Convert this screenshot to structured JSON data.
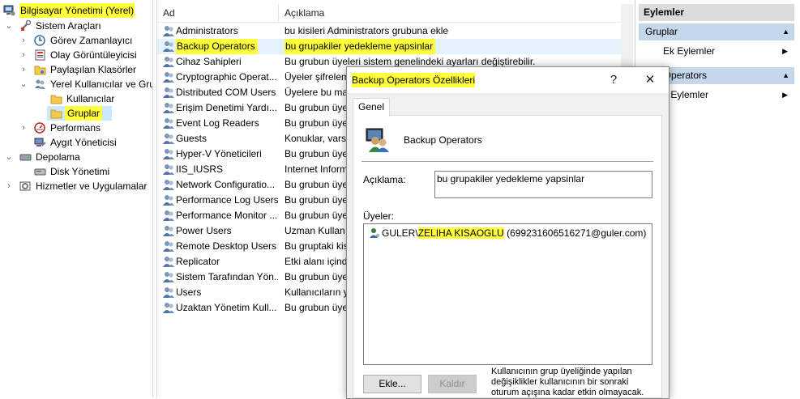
{
  "tree": {
    "root": "Bilgisayar Yönetimi (Yerel)",
    "items": [
      {
        "label": "Sistem Araçları"
      },
      {
        "label": "Görev Zamanlayıcı"
      },
      {
        "label": "Olay Görüntüleyicisi"
      },
      {
        "label": "Paylaşılan Klasörler"
      },
      {
        "label": "Yerel Kullanıcılar ve Gru"
      },
      {
        "label": "Kullanıcılar"
      },
      {
        "label": "Gruplar"
      },
      {
        "label": "Performans"
      },
      {
        "label": "Aygıt Yöneticisi"
      },
      {
        "label": "Depolama"
      },
      {
        "label": "Disk Yönetimi"
      },
      {
        "label": "Hizmetler ve Uygulamalar"
      }
    ]
  },
  "list": {
    "columns": {
      "name": "Ad",
      "description": "Açıklama"
    },
    "rows": [
      {
        "name": "Administrators",
        "desc": "bu kisileri Administrators grubuna ekle"
      },
      {
        "name": "Backup Operators",
        "desc": "bu grupakiler yedekleme yapsinlar"
      },
      {
        "name": "Cihaz Sahipleri",
        "desc": "Bu grubun üyeleri sistem genelindeki ayarları değiştirebilir."
      },
      {
        "name": "Cryptographic Operat...",
        "desc": "Üyeler şifrelem"
      },
      {
        "name": "Distributed COM Users",
        "desc": "Üyelere bu ma"
      },
      {
        "name": "Erişim Denetimi Yardı...",
        "desc": "Bu grubun üye"
      },
      {
        "name": "Event Log Readers",
        "desc": "Bu grubun üye"
      },
      {
        "name": "Guests",
        "desc": "Konuklar, varsa"
      },
      {
        "name": "Hyper-V Yöneticileri",
        "desc": "Bu grubun üye"
      },
      {
        "name": "IIS_IUSRS",
        "desc": "Internet Inform"
      },
      {
        "name": "Network Configuratio...",
        "desc": "Bu grubun üye"
      },
      {
        "name": "Performance Log Users",
        "desc": "Bu grubun üye"
      },
      {
        "name": "Performance Monitor ...",
        "desc": "Bu grubun üye"
      },
      {
        "name": "Power Users",
        "desc": "Uzman Kullan"
      },
      {
        "name": "Remote Desktop Users",
        "desc": "Bu gruptaki kis"
      },
      {
        "name": "Replicator",
        "desc": "Etki alanı içind"
      },
      {
        "name": "Sistem Tarafından Yön...",
        "desc": "Bu grubun üye"
      },
      {
        "name": "Users",
        "desc": "Kullanıcıların y"
      },
      {
        "name": "Uzaktan Yönetim Kull...",
        "desc": "Bu grubun üye"
      }
    ]
  },
  "actions": {
    "header": "Eylemler",
    "section1": "Gruplar",
    "more1": "Ek Eylemler",
    "section2": "kup Operators",
    "more2": "k Eylemler"
  },
  "dialog": {
    "title": "Backup Operators Özellikleri",
    "help": "?",
    "close": "✕",
    "tab": "Genel",
    "group_name": "Backup Operators",
    "desc_label": "Açıklama:",
    "desc_value": "bu grupakiler yedekleme yapsinlar",
    "members_label": "Üyeler:",
    "member_prefix": "GULER\\",
    "member_name": "ZELIHA KISAOGLU",
    "member_suffix": " (699231606516271@guler.com)",
    "add": "Ekle...",
    "remove": "Kaldır",
    "note": "Kullanıcının grup üyeliğinde yapılan değişiklikler kullanıcının bir sonraki oturum açışına kadar etkin olmayacak."
  },
  "colors": {
    "highlight": "#ffff3a",
    "selection": "#e5f1fb",
    "actions_header": "#dcdcdc"
  }
}
